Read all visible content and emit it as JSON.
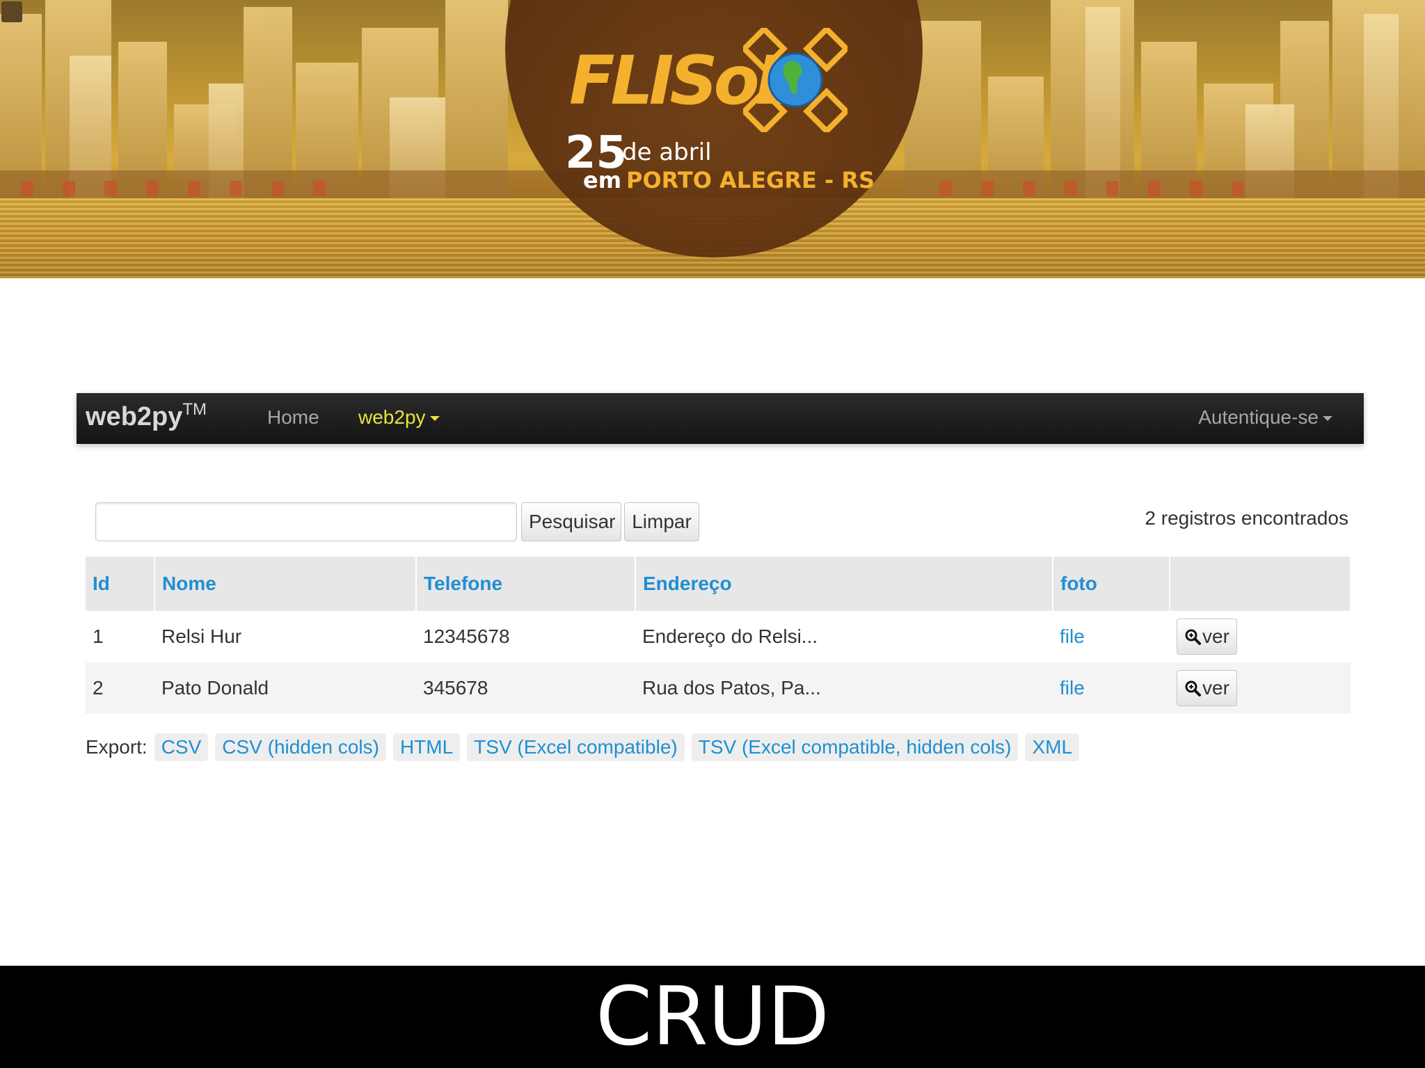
{
  "banner": {
    "logo_word": "FLISoL",
    "day": "25",
    "date_text": "de abril",
    "em": "em",
    "city": "PORTO ALEGRE - RS"
  },
  "navbar": {
    "brand": "web2py",
    "brand_tm": "TM",
    "home": "Home",
    "web2py_menu": "web2py",
    "login": "Autentique-se"
  },
  "search": {
    "value": "",
    "search_button": "Pesquisar",
    "clear_button": "Limpar",
    "records_found": "2 registros encontrados"
  },
  "table": {
    "headers": [
      "Id",
      "Nome",
      "Telefone",
      "Endereço",
      "foto",
      ""
    ],
    "rows": [
      {
        "id": "1",
        "nome": "Relsi Hur",
        "telefone": "12345678",
        "endereco": "Endereço do Relsi...",
        "foto": "file",
        "action": "ver"
      },
      {
        "id": "2",
        "nome": "Pato Donald",
        "telefone": "345678",
        "endereco": "Rua dos Patos, Pa...",
        "foto": "file",
        "action": "ver"
      }
    ]
  },
  "export": {
    "label": "Export:",
    "links": [
      "CSV",
      "CSV (hidden cols)",
      "HTML",
      "TSV (Excel compatible)",
      "TSV (Excel compatible, hidden cols)",
      "XML"
    ]
  },
  "footer": {
    "title": "CRUD"
  },
  "colors": {
    "link": "#1f8fd1",
    "navbar_bg": "#1b1b1b",
    "active_menu": "#e7e53b",
    "banner_gold": "#f3b12e"
  },
  "icons": [
    "zoom-in-icon",
    "caret-down-icon",
    "globe-icon"
  ]
}
